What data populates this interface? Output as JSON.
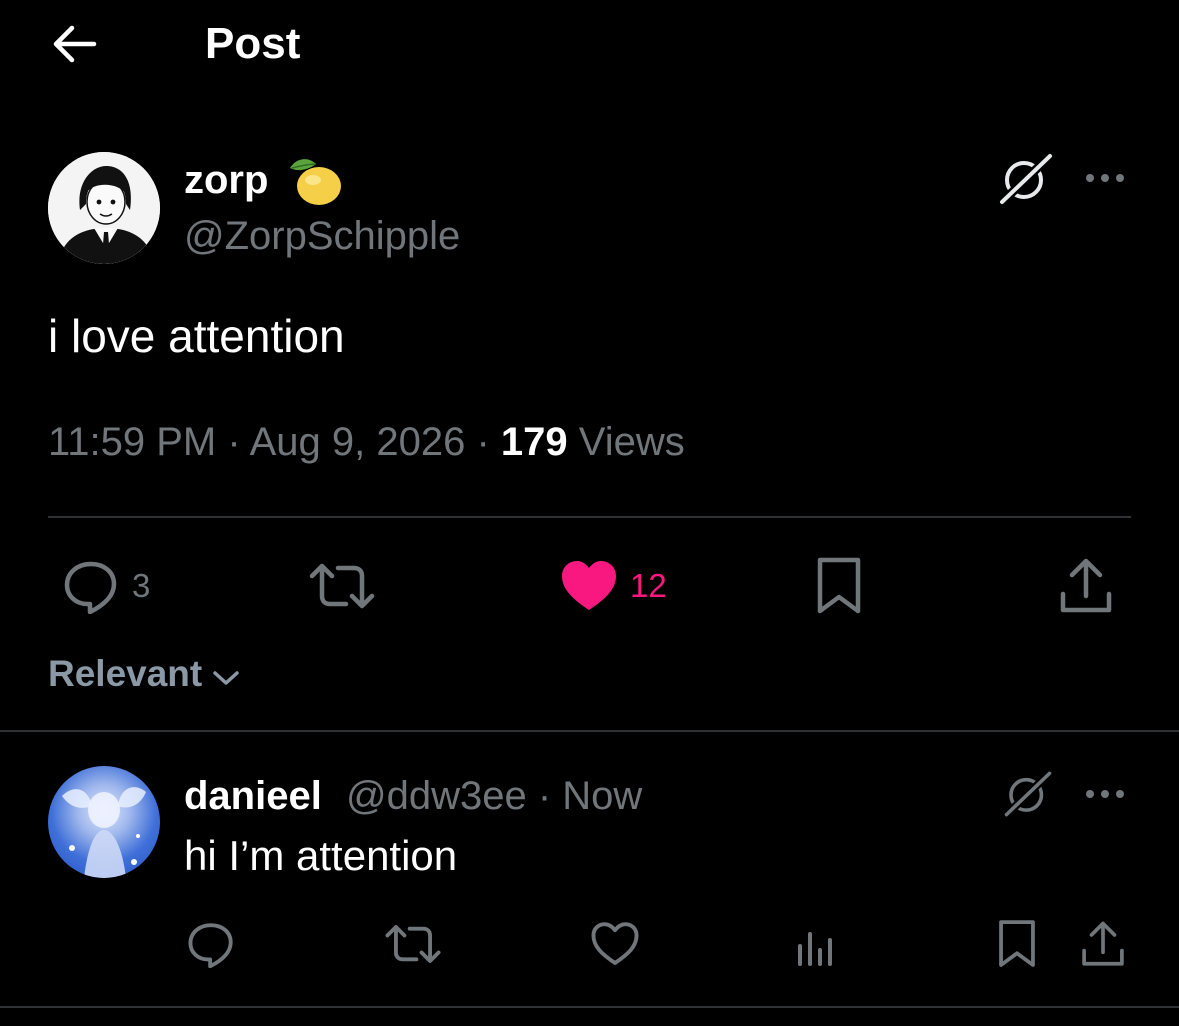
{
  "header": {
    "title": "Post",
    "back_icon": "arrow-left-icon"
  },
  "post": {
    "author_name": "zorp",
    "author_emoji": "lemon",
    "author_handle": "@ZorpSchipple",
    "text": "i love attention",
    "time": "11:59 PM",
    "date": "Aug 9, 2026",
    "separator": " · ",
    "views_count": "179",
    "views_label": "Views",
    "actions": {
      "reply_count": "3",
      "like_count": "12",
      "liked": true
    }
  },
  "sort": {
    "label": "Relevant"
  },
  "reply": {
    "author_name": "danieel",
    "author_handle": "@ddw3ee · Now",
    "text": "hi I’m attention"
  },
  "colors": {
    "background": "#000000",
    "text": "#e7e9ea",
    "muted": "#71767b",
    "like": "#f91880",
    "divider": "#2f3336"
  }
}
